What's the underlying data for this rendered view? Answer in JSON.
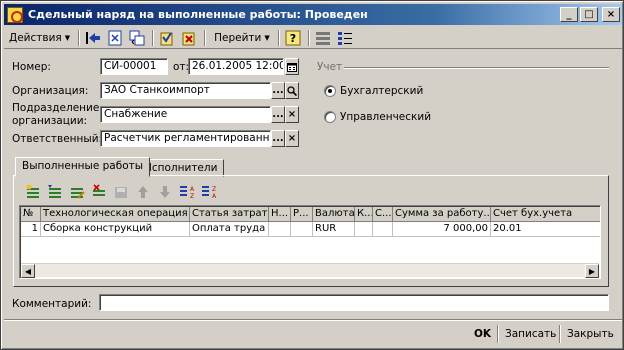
{
  "window": {
    "title": "Сдельный наряд на выполненные работы: Проведен",
    "min_glyph": "_",
    "max_glyph": "□",
    "close_glyph": "×"
  },
  "toolbar": {
    "actions_label": "Действия",
    "goto_label": "Перейти",
    "help_glyph": "?",
    "icons": [
      "back-arrow-icon",
      "document-icon",
      "swap-icon",
      "post-document-icon",
      "unpost-document-icon",
      "structure-icon",
      "settings-list-icon"
    ]
  },
  "form": {
    "number_label": "Номер:",
    "number_value": "СИ-00001",
    "date_label": "от:",
    "date_value": "26.01.2005 12:00:0",
    "org_label": "Организация:",
    "org_value": "ЗАО Станкоимпорт",
    "division_label_1": "Подразделение",
    "division_label_2": "организации:",
    "division_value": "Снабжение",
    "responsible_label": "Ответственный:",
    "responsible_value": "Расчетчик регламентированной :",
    "select_glyph": "...",
    "search_glyph": "🔍",
    "clear_glyph": "×"
  },
  "accounting": {
    "group_title": "Учет",
    "option_1": "Бухгалтерский",
    "option_2": "Управленческий",
    "selected": "Бухгалтерский"
  },
  "tabs": [
    {
      "label": "Выполненные работы",
      "active": true
    },
    {
      "label": "Исполнители",
      "active": false
    }
  ],
  "table_toolbar": {
    "icons": [
      "add-row-icon",
      "copy-row-icon",
      "edit-row-icon",
      "delete-row-icon",
      "save-icon",
      "move-up-icon",
      "move-down-icon",
      "sort-asc-icon",
      "sort-desc-icon"
    ]
  },
  "table": {
    "columns": [
      "№",
      "Технологическая операция",
      "Статья затрат",
      "Н...",
      "Р...",
      "Валюта",
      "К...",
      "С...",
      "Сумма за работу...",
      "Счет бух.учета"
    ],
    "rows": [
      [
        "1",
        "Сборка конструкций",
        "Оплата труда",
        "",
        "",
        "RUR",
        "",
        "",
        "7 000,00",
        "20.01"
      ]
    ]
  },
  "comment": {
    "label": "Комментарий:",
    "value": ""
  },
  "footer": {
    "ok_label": "OK",
    "write_label": "Записать",
    "close_label": "Закрыть"
  }
}
